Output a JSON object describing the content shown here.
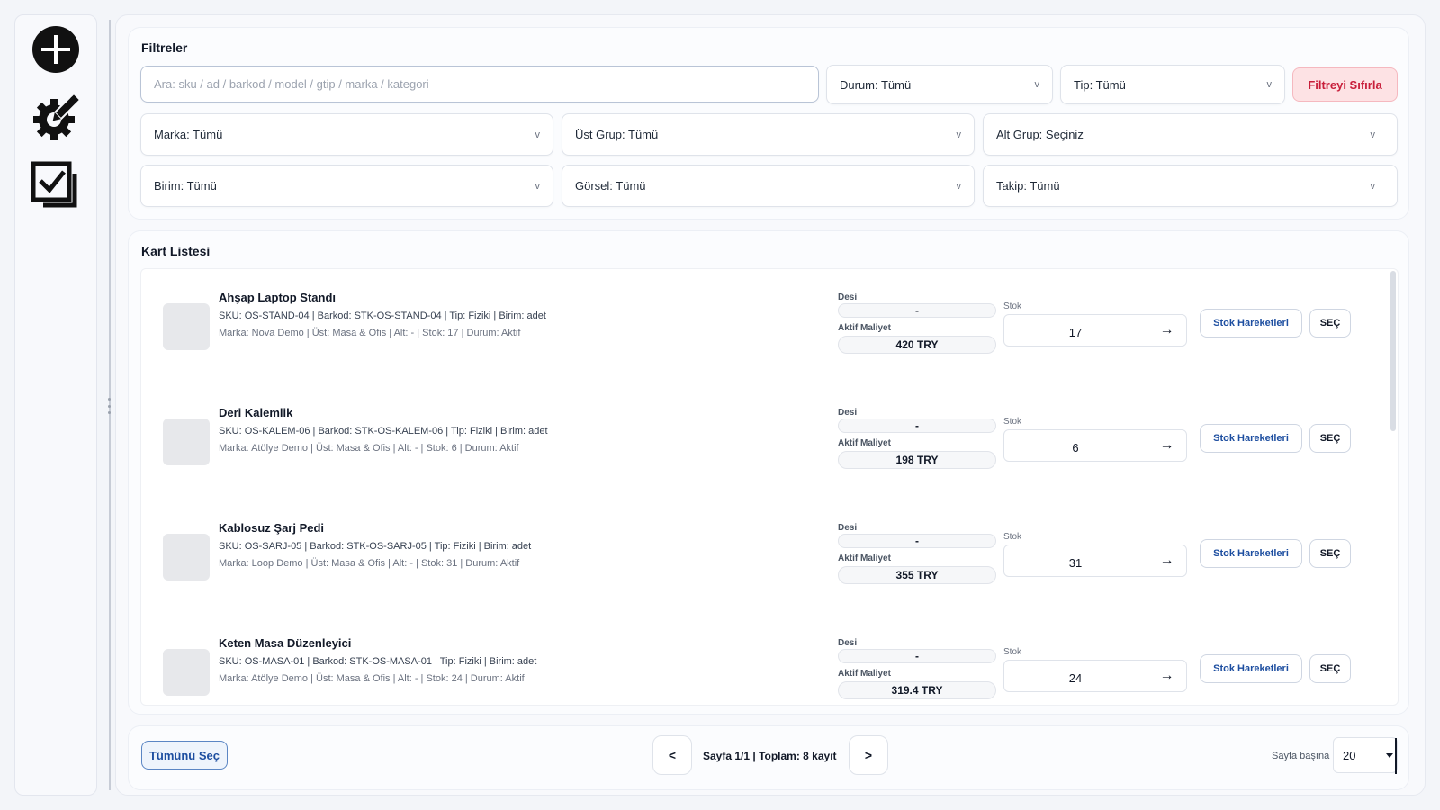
{
  "filters": {
    "title": "Filtreler",
    "search_placeholder": "Ara: sku / ad / barkod / model / gtip / marka / kategori",
    "durum": "Durum: Tümü",
    "tip": "Tip: Tümü",
    "reset_label": "Filtreyi Sıfırla",
    "marka": "Marka: Tümü",
    "ust_grup": "Üst Grup: Tümü",
    "alt_grup": "Alt Grup: Seçiniz",
    "birim": "Birim: Tümü",
    "gorsel": "Görsel: Tümü",
    "takip": "Takip: Tümü",
    "chevron": "v"
  },
  "list": {
    "title": "Kart Listesi",
    "desi_label": "Desi",
    "maliyet_label": "Aktif Maliyet",
    "stok_label": "Stok",
    "hareket_label": "Stok Hareketleri",
    "sec_label": "SEÇ",
    "arrow": "→",
    "items": [
      {
        "name": "Ahşap Laptop Standı",
        "line1": "SKU: OS-STAND-04 | Barkod: STK-OS-STAND-04 | Tip: Fiziki | Birim: adet",
        "line2": "Marka: Nova Demo | Üst: Masa & Ofis | Alt: - | Stok: 17 | Durum: Aktif",
        "desi": "-",
        "maliyet": "420 TRY",
        "stok": "17"
      },
      {
        "name": "Deri Kalemlik",
        "line1": "SKU: OS-KALEM-06 | Barkod: STK-OS-KALEM-06 | Tip: Fiziki | Birim: adet",
        "line2": "Marka: Atölye Demo | Üst: Masa & Ofis | Alt: - | Stok: 6 | Durum: Aktif",
        "desi": "-",
        "maliyet": "198 TRY",
        "stok": "6"
      },
      {
        "name": "Kablosuz Şarj Pedi",
        "line1": "SKU: OS-SARJ-05 | Barkod: STK-OS-SARJ-05 | Tip: Fiziki | Birim: adet",
        "line2": "Marka: Loop Demo | Üst: Masa & Ofis | Alt: - | Stok: 31 | Durum: Aktif",
        "desi": "-",
        "maliyet": "355 TRY",
        "stok": "31"
      },
      {
        "name": "Keten Masa Düzenleyici",
        "line1": "SKU: OS-MASA-01 | Barkod: STK-OS-MASA-01 | Tip: Fiziki | Birim: adet",
        "line2": "Marka: Atölye Demo | Üst: Masa & Ofis | Alt: - | Stok: 24 | Durum: Aktif",
        "desi": "-",
        "maliyet": "319.4 TRY",
        "stok": "24"
      }
    ]
  },
  "footer": {
    "select_all": "Tümünü Seç",
    "prev": "<",
    "next": ">",
    "page_info": "Sayfa 1/1 | Toplam: 8 kayıt",
    "per_page_label": "Sayfa başına",
    "per_page_value": "20"
  },
  "sidebar": {
    "icons": [
      "plus-circle-icon",
      "gear-edit-icon",
      "checklist-icon"
    ]
  }
}
